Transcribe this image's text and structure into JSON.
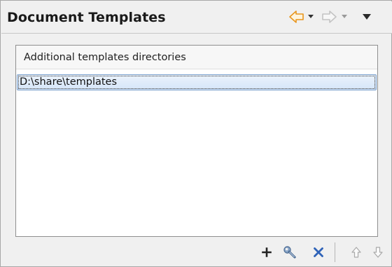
{
  "header": {
    "title": "Document Templates",
    "back_icon": "back-arrow-icon",
    "forward_icon": "forward-arrow-icon",
    "menu_icon": "view-menu-icon",
    "accent_color": "#f0a030"
  },
  "table": {
    "column_header": "Additional templates directories",
    "rows": [
      {
        "path": "D:\\share\\templates",
        "selected": true
      }
    ]
  },
  "toolbar": {
    "add_icon": "plus-icon",
    "edit_icon": "wrench-icon",
    "remove_icon": "delete-x-icon",
    "move_up_icon": "arrow-up-icon",
    "move_down_icon": "arrow-down-icon"
  }
}
